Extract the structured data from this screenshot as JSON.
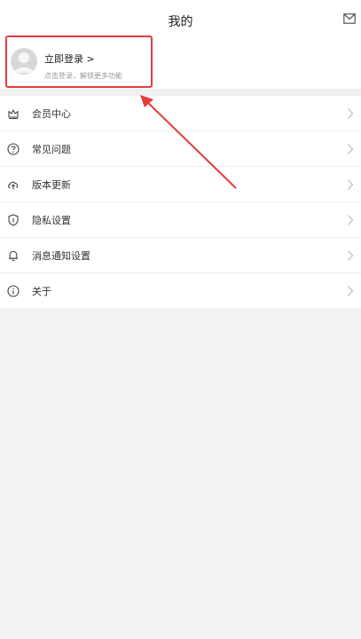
{
  "header": {
    "title": "我的",
    "mail_icon": "mail-icon"
  },
  "login": {
    "title": "立即登录 >",
    "subtitle": "点击登录，解锁更多功能",
    "avatar_icon": "avatar-icon"
  },
  "menu": {
    "items": [
      {
        "label": "会员中心",
        "icon": "vip-crown-icon"
      },
      {
        "label": "常见问题",
        "icon": "question-icon"
      },
      {
        "label": "版本更新",
        "icon": "update-icon"
      },
      {
        "label": "隐私设置",
        "icon": "privacy-shield-icon"
      },
      {
        "label": "消息通知设置",
        "icon": "bell-icon"
      },
      {
        "label": "关于",
        "icon": "info-icon"
      }
    ]
  },
  "colors": {
    "highlight": "#e43b3b",
    "background": "#f2f2f2",
    "panel": "#ffffff"
  }
}
